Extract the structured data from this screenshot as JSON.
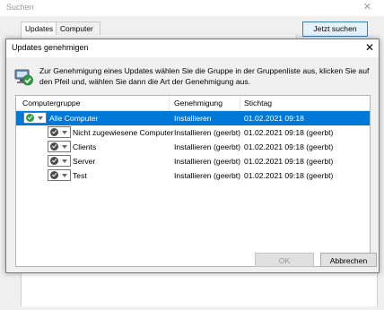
{
  "background_window": {
    "title": "Suchen",
    "close_glyph": "✕",
    "tabs": [
      "Updates",
      "Computer"
    ],
    "search_button": "Jetzt suchen"
  },
  "dialog": {
    "title": "Updates genehmigen",
    "close_glyph": "✕",
    "instruction": "Zur Genehmigung eines Updates wählen Sie die Gruppe in der Gruppenliste aus, klicken Sie auf den Pfeil und, wählen Sie dann die Art der Genehmigung aus.",
    "columns": [
      "Computergruppe",
      "Genehmigung",
      "Stichtag"
    ],
    "rows": [
      {
        "group": "Alle Computer",
        "approval": "Installieren",
        "deadline": "01.02.2021 09:18",
        "level": 0,
        "selected": true,
        "icon": "check-green-icon"
      },
      {
        "group": "Nicht zugewiesene Computer",
        "approval": "Installieren (geerbt)",
        "deadline": "01.02.2021 09:18 (geerbt)",
        "level": 1,
        "selected": false,
        "icon": "check-gray-icon"
      },
      {
        "group": "Clients",
        "approval": "Installieren (geerbt)",
        "deadline": "01.02.2021 09:18 (geerbt)",
        "level": 1,
        "selected": false,
        "icon": "check-gray-icon"
      },
      {
        "group": "Server",
        "approval": "Installieren (geerbt)",
        "deadline": "01.02.2021 09:18 (geerbt)",
        "level": 1,
        "selected": false,
        "icon": "check-gray-icon"
      },
      {
        "group": "Test",
        "approval": "Installieren (geerbt)",
        "deadline": "01.02.2021 09:18 (geerbt)",
        "level": 1,
        "selected": false,
        "icon": "check-gray-icon"
      }
    ],
    "buttons": {
      "ok": "OK",
      "cancel": "Abbrechen"
    },
    "colors": {
      "selection": "#0078d7",
      "approved_icon": "#2f9e44"
    }
  }
}
